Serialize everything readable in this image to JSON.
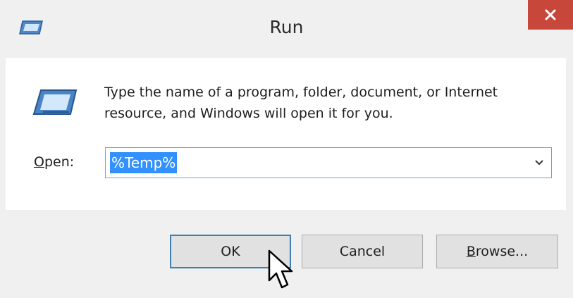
{
  "window": {
    "title": "Run",
    "app_icon": "run-icon",
    "close_icon": "close-icon"
  },
  "dialog": {
    "icon": "run-icon",
    "description": "Type the name of a program, folder, document, or Internet resource, and Windows will open it for you.",
    "open_label_access_key": "O",
    "open_label_rest": "pen:",
    "open_value": "%Temp%",
    "open_value_selected": true,
    "dropdown_icon": "chevron-down-icon"
  },
  "buttons": {
    "ok_label": "OK",
    "cancel_label": "Cancel",
    "browse_access_key": "B",
    "browse_rest": "rowse..."
  },
  "colors": {
    "close_button": "#c7473a",
    "selection": "#3390ff",
    "focused_border": "#3c7fb1"
  }
}
